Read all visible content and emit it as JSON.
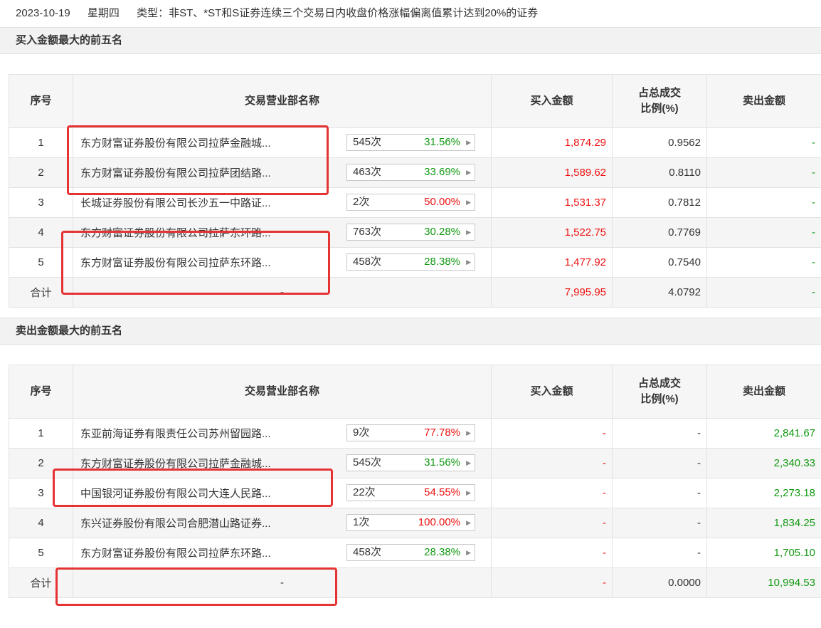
{
  "header": {
    "date": "2023-10-19",
    "weekday": "星期四",
    "type_text": "类型：非ST、*ST和S证券连续三个交易日内收盘价格涨幅偏离值累计达到20%的证券"
  },
  "columns": {
    "idx": "序号",
    "name": "交易营业部名称",
    "buy": "买入金额",
    "ratio_line1": "占总成交",
    "ratio_line2": "比例(%)",
    "sell": "卖出金额"
  },
  "buy_section": {
    "title": "买入金额最大的前五名",
    "rows": [
      {
        "idx": "1",
        "name": "东方财富证券股份有限公司拉萨金融城...",
        "count": "545次",
        "pct": "31.56%",
        "buy": "1,874.29",
        "ratio": "0.9562",
        "sell": "-"
      },
      {
        "idx": "2",
        "name": "东方财富证券股份有限公司拉萨团结路...",
        "count": "463次",
        "pct": "33.69%",
        "buy": "1,589.62",
        "ratio": "0.8110",
        "sell": "-"
      },
      {
        "idx": "3",
        "name": "长城证券股份有限公司长沙五一中路证...",
        "count": "2次",
        "pct": "50.00%",
        "buy": "1,531.37",
        "ratio": "0.7812",
        "sell": "-"
      },
      {
        "idx": "4",
        "name": "东方财富证券股份有限公司拉萨东环路...",
        "count": "763次",
        "pct": "30.28%",
        "buy": "1,522.75",
        "ratio": "0.7769",
        "sell": "-"
      },
      {
        "idx": "5",
        "name": "东方财富证券股份有限公司拉萨东环路...",
        "count": "458次",
        "pct": "28.38%",
        "buy": "1,477.92",
        "ratio": "0.7540",
        "sell": "-"
      }
    ],
    "total": {
      "label": "合计",
      "name": "-",
      "buy": "7,995.95",
      "ratio": "4.0792",
      "sell": "-"
    }
  },
  "sell_section": {
    "title": "卖出金额最大的前五名",
    "rows": [
      {
        "idx": "1",
        "name": "东亚前海证券有限责任公司苏州留园路...",
        "count": "9次",
        "pct": "77.78%",
        "buy": "-",
        "ratio": "-",
        "sell": "2,841.67"
      },
      {
        "idx": "2",
        "name": "东方财富证券股份有限公司拉萨金融城...",
        "count": "545次",
        "pct": "31.56%",
        "buy": "-",
        "ratio": "-",
        "sell": "2,340.33"
      },
      {
        "idx": "3",
        "name": "中国银河证券股份有限公司大连人民路...",
        "count": "22次",
        "pct": "54.55%",
        "buy": "-",
        "ratio": "-",
        "sell": "2,273.18"
      },
      {
        "idx": "4",
        "name": "东兴证券股份有限公司合肥潜山路证券...",
        "count": "1次",
        "pct": "100.00%",
        "buy": "-",
        "ratio": "-",
        "sell": "1,834.25"
      },
      {
        "idx": "5",
        "name": "东方财富证券股份有限公司拉萨东环路...",
        "count": "458次",
        "pct": "28.38%",
        "buy": "-",
        "ratio": "-",
        "sell": "1,705.10"
      }
    ],
    "total": {
      "label": "合计",
      "name": "-",
      "buy": "-",
      "ratio": "0.0000",
      "sell": "10,994.53"
    }
  },
  "colors": {
    "up_red": "#ee1111",
    "down_green": "#119911",
    "highlight_box": "#e53333"
  }
}
